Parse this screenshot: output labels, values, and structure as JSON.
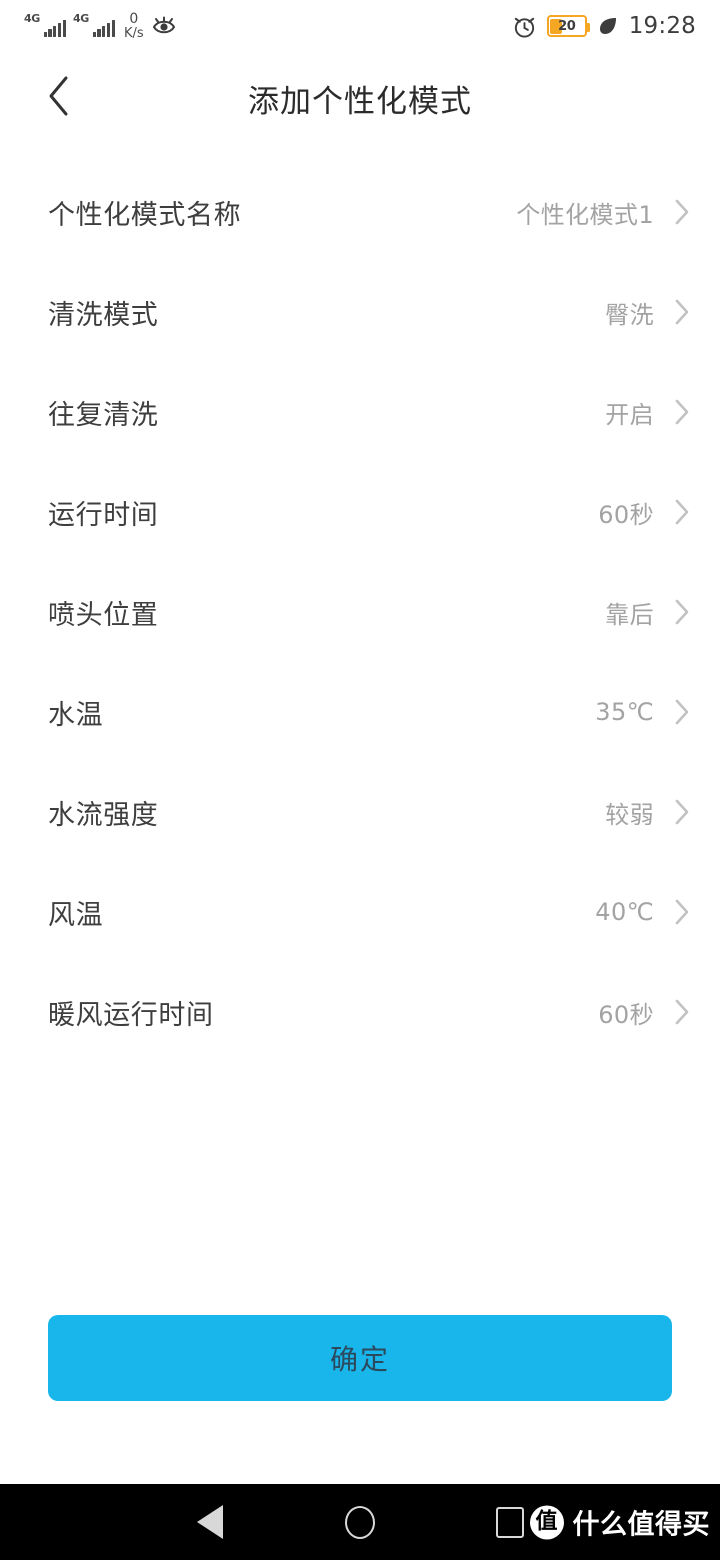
{
  "status_bar": {
    "sim1_network": "4G",
    "sim2_network": "4G",
    "net_speed_value": "0",
    "net_speed_unit": "K/s",
    "eye_comfort_icon": "eye-icon",
    "alarm_icon": "alarm-clock-icon",
    "battery_percent": "20",
    "battery_color": "#f5a623",
    "power_saving_icon": "leaf-icon",
    "time": "19:28"
  },
  "header": {
    "back_icon": "chevron-left-icon",
    "title": "添加个性化模式"
  },
  "settings": {
    "chevron_icon": "chevron-right-icon",
    "rows": [
      {
        "label": "个性化模式名称",
        "value": "个性化模式1"
      },
      {
        "label": "清洗模式",
        "value": "臀洗"
      },
      {
        "label": "往复清洗",
        "value": "开启"
      },
      {
        "label": "运行时间",
        "value": "60秒"
      },
      {
        "label": "喷头位置",
        "value": "靠后"
      },
      {
        "label": "水温",
        "value": "35℃"
      },
      {
        "label": "水流强度",
        "value": "较弱"
      },
      {
        "label": "风温",
        "value": "40℃"
      },
      {
        "label": "暖风运行时间",
        "value": "60秒"
      }
    ]
  },
  "footer": {
    "confirm_label": "确定",
    "confirm_color": "#19b6ec"
  },
  "nav_bar": {
    "back_icon": "triangle-back-icon",
    "home_icon": "circle-home-icon",
    "recents_icon": "square-recents-icon",
    "watermark_logo": "值",
    "watermark_text": "什么值得买"
  }
}
